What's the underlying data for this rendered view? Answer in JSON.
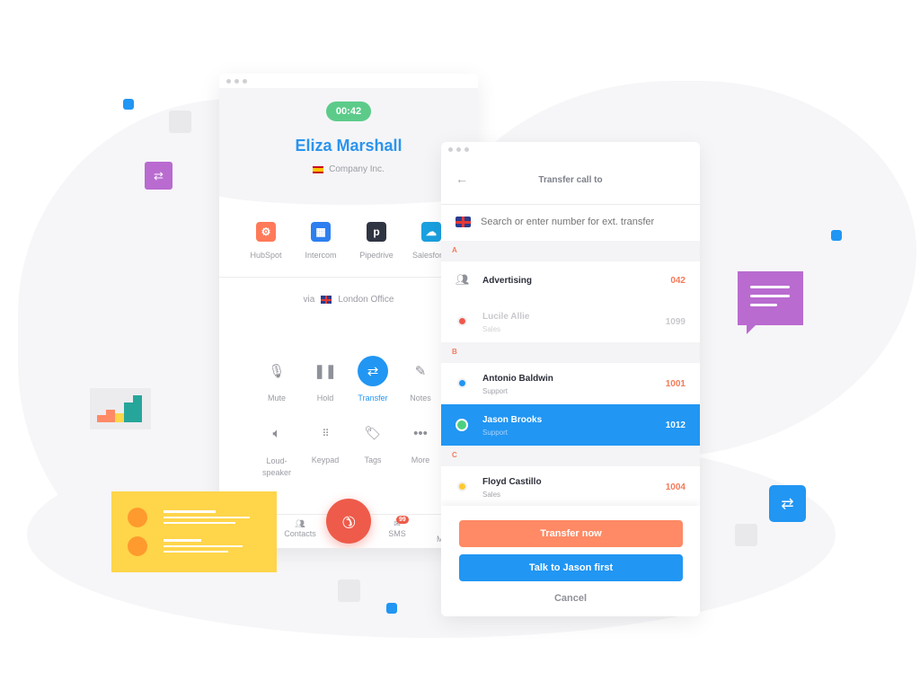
{
  "call_panel": {
    "timer": "00:42",
    "caller_name": "Eliza Marshall",
    "company": "Company Inc.",
    "integrations": [
      {
        "label": "HubSpot",
        "color": "#ff7a59"
      },
      {
        "label": "Intercom",
        "color": "#2d7ff0"
      },
      {
        "label": "Pipedrive",
        "color": "#2f3542"
      },
      {
        "label": "Salesforce",
        "color": "#1ba0e0"
      }
    ],
    "via_label": "via",
    "via_line": "London Office",
    "actions": [
      {
        "label": "Mute",
        "icon": "mic-off-icon"
      },
      {
        "label": "Hold",
        "icon": "pause-icon"
      },
      {
        "label": "Transfer",
        "icon": "transfer-icon",
        "active": true
      },
      {
        "label": "Notes",
        "icon": "pencil-icon"
      },
      {
        "label": "Loud-",
        "label2": "speaker",
        "icon": "speaker-icon"
      },
      {
        "label": "Keypad",
        "icon": "keypad-icon"
      },
      {
        "label": "Tags",
        "icon": "tag-icon"
      },
      {
        "label": "More",
        "icon": "more-icon"
      }
    ],
    "bottom_nav": {
      "contacts": "Contacts",
      "sms": "SMS",
      "sms_badge": "99",
      "more": "M"
    }
  },
  "transfer_panel": {
    "title": "Transfer call to",
    "search_placeholder": "Search or enter number for ext. transfer",
    "sections": [
      {
        "letter": "A",
        "rows": [
          {
            "name": "Advertising",
            "sub": "",
            "number": "042",
            "status": "group"
          },
          {
            "name": "Lucile Allie",
            "sub": "Sales",
            "number": "1099",
            "status": "#f0584a",
            "disabled": true
          }
        ]
      },
      {
        "letter": "B",
        "rows": [
          {
            "name": "Antonio Baldwin",
            "sub": "Support",
            "number": "1001",
            "status": "#2196f3"
          },
          {
            "name": "Jason Brooks",
            "sub": "Support",
            "number": "1012",
            "status": "#4cd080",
            "selected": true
          }
        ]
      },
      {
        "letter": "C",
        "rows": [
          {
            "name": "Floyd Castillo",
            "sub": "Sales",
            "number": "1004",
            "status": "#ffc930"
          }
        ]
      }
    ],
    "transfer_now": "Transfer now",
    "talk_first": "Talk to Jason first",
    "cancel": "Cancel"
  },
  "colors": {
    "accent": "#2196f3",
    "orange": "#ff8a65",
    "green": "#5ccb8a",
    "end_call": "#ee5b4a",
    "purple": "#b96bd0",
    "yellow": "#ffd54a"
  }
}
